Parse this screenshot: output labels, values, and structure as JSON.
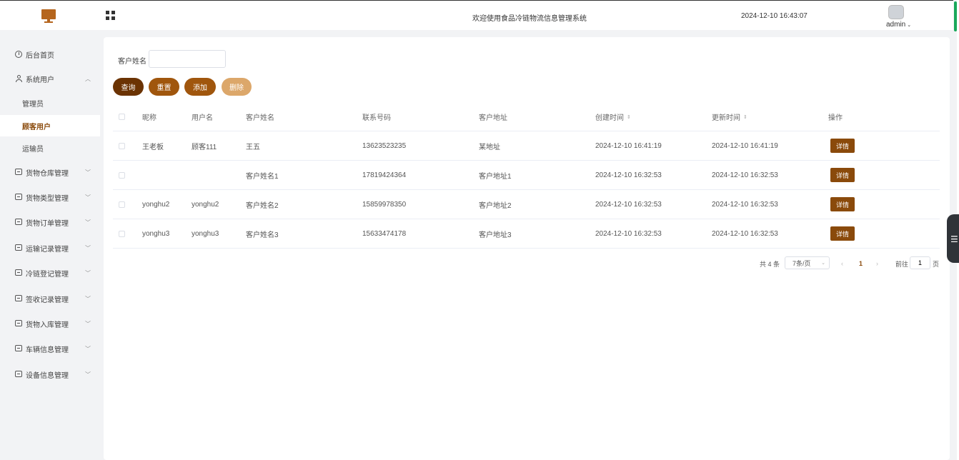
{
  "header": {
    "welcome": "欢迎使用食品冷链物流信息管理系统",
    "datetime": "2024-12-10 16:43:07",
    "user": "admin"
  },
  "sidebar": {
    "home": "后台首页",
    "system_users": "系统用户",
    "sub_items": [
      "管理员",
      "顾客用户",
      "运输员"
    ],
    "items": [
      "货物仓库管理",
      "货物类型管理",
      "货物订单管理",
      "运输记录管理",
      "冷链登记管理",
      "签收记录管理",
      "货物入库管理",
      "车辆信息管理",
      "设备信息管理"
    ]
  },
  "search": {
    "label": "客户姓名",
    "value": ""
  },
  "buttons": {
    "query": "查询",
    "reset": "重置",
    "add": "添加",
    "delete": "删除"
  },
  "table": {
    "headers": [
      "昵称",
      "用户名",
      "客户姓名",
      "联系号码",
      "客户地址",
      "创建时间",
      "更新时间",
      "操作"
    ],
    "detail_label": "详情",
    "rows": [
      [
        "王老板",
        "顾客111",
        "王五",
        "13623523235",
        "某地址",
        "2024-12-10 16:41:19",
        "2024-12-10 16:41:19"
      ],
      [
        "",
        "",
        "客户姓名1",
        "17819424364",
        "客户地址1",
        "2024-12-10 16:32:53",
        "2024-12-10 16:32:53"
      ],
      [
        "yonghu2",
        "yonghu2",
        "客户姓名2",
        "15859978350",
        "客户地址2",
        "2024-12-10 16:32:53",
        "2024-12-10 16:32:53"
      ],
      [
        "yonghu3",
        "yonghu3",
        "客户姓名3",
        "15633474178",
        "客户地址3",
        "2024-12-10 16:32:53",
        "2024-12-10 16:32:53"
      ]
    ]
  },
  "pagination": {
    "total": "共 4 条",
    "page_size": "7条/页",
    "current_page": "1",
    "goto_label": "前往",
    "goto_value": "1",
    "page_unit": "页"
  },
  "colors": {
    "accent": "#8a4a0b",
    "query": "#6b3303",
    "button": "#a0560d",
    "delete": "#dca76a"
  }
}
